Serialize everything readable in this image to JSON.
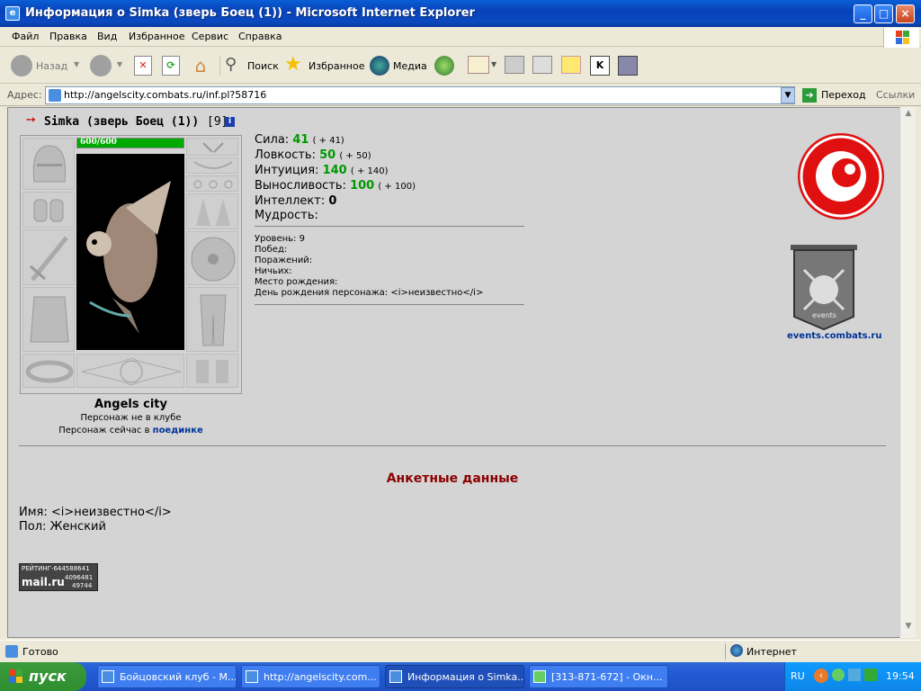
{
  "window": {
    "title": "Информация о Simka (зверь Боец (1)) - Microsoft Internet Explorer"
  },
  "menu": [
    "Файл",
    "Правка",
    "Вид",
    "Избранное",
    "Сервис",
    "Справка"
  ],
  "toolbar": {
    "back": "Назад",
    "search": "Поиск",
    "favorites": "Избранное",
    "media": "Медиа"
  },
  "address": {
    "label": "Адрес:",
    "url": "http://angelscity.combats.ru/inf.pl?58716",
    "go": "Переход",
    "links": "Ссылки"
  },
  "character": {
    "name": "Simka (зверь Боец (1))",
    "level_badge": "[9]",
    "hp": "600/600",
    "city": "Angels city",
    "club_status": "Персонаж не в клубе",
    "battle_prefix": "Персонаж сейчас в",
    "battle_link": "поединке"
  },
  "stats": [
    {
      "label": "Сила:",
      "value": "41",
      "bonus": "( + 41)"
    },
    {
      "label": "Ловкость:",
      "value": "50",
      "bonus": "( + 50)"
    },
    {
      "label": "Интуиция:",
      "value": "140",
      "bonus": "( + 140)"
    },
    {
      "label": "Выносливость:",
      "value": "100",
      "bonus": "( + 100)"
    },
    {
      "label": "Интеллект:",
      "value": "0",
      "bonus": ""
    },
    {
      "label": "Мудрость:",
      "value": "",
      "bonus": ""
    }
  ],
  "info": [
    "Уровень: 9",
    "Побед:",
    "Поражений:",
    "Ничьих:",
    "Место рождения:",
    "День рождения персонажа: <i>неизвестно</i>"
  ],
  "side": {
    "events_link": "events.combats.ru",
    "events_badge": "events"
  },
  "questionnaire": {
    "title": "Анкетные данные",
    "name_line": "Имя: <i>неизвестно</i>",
    "gender_line": "Пол: Женский"
  },
  "counter": {
    "label": "РЕЙТИНГ-644588641",
    "brand": "mail.ru",
    "n1": "4096481",
    "n2": "49744"
  },
  "status": {
    "left": "Готово",
    "zone": "Интернет"
  },
  "taskbar": {
    "start": "пуск",
    "tasks": [
      "Бойцовский клуб - M...",
      "http://angelscity.com...",
      "Информация о Simka...",
      "[313-871-672] - Окн..."
    ],
    "lang": "RU",
    "clock": "19:54"
  },
  "colors": {
    "titlebar": "#0842b8",
    "green_stat": "#009900",
    "section_title": "#8b0000",
    "link": "#003399",
    "hpbar": "#00aa00"
  }
}
